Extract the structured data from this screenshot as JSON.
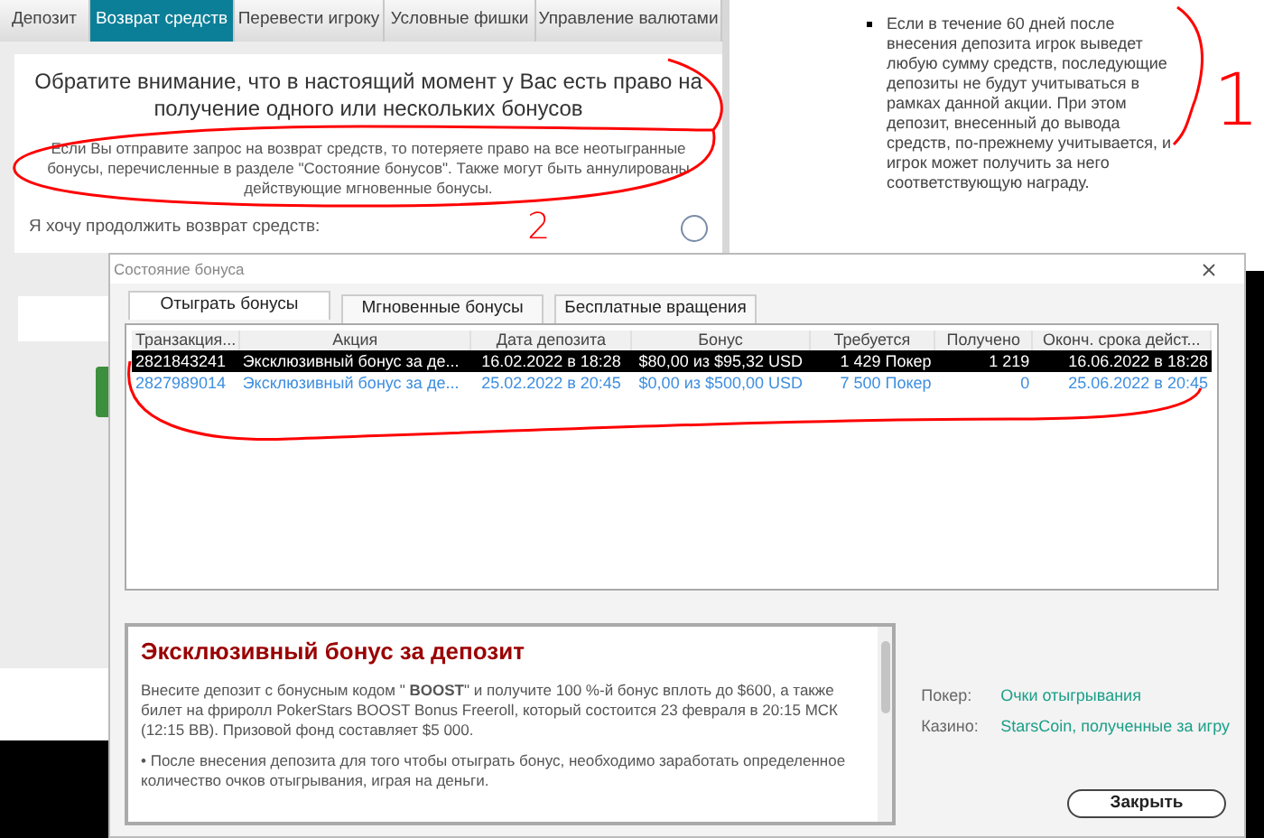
{
  "top_tabs": [
    {
      "label": "Депозит",
      "selected": false
    },
    {
      "label": "Возврат средств",
      "selected": true
    },
    {
      "label": "Перевести игроку",
      "selected": false
    },
    {
      "label": "Условные фишки",
      "selected": false
    },
    {
      "label": "Управление валютами",
      "selected": false
    }
  ],
  "notice": {
    "heading": "Обратите внимание, что в настоящий момент у Вас есть право на получение одного или нескольких бонусов",
    "text": "Если Вы отправите запрос на возврат средств, то потеряете право на все неотыгранные бонусы, перечисленные в разделе \"Состояние бонусов\". Также могут быть аннулированы действующие мгновенные бонусы.",
    "confirm_label": "Я хочу продолжить возврат средств:",
    "confirm_checked": false
  },
  "side_note": {
    "bullet": "Если в течение 60 дней после внесения депозита игрок выведет любую сумму средств, последующие депозиты не будут учитываться в рамках данной акции. При этом депозит, внесенный до вывода средств, по-прежнему учитывается, и игрок может получить за него соответствующую награду."
  },
  "annotations": [
    {
      "label": "1"
    },
    {
      "label": "2"
    }
  ],
  "dialog": {
    "title": "Состояние бонуса",
    "tabs": [
      {
        "label": "Отыграть бонусы",
        "selected": true
      },
      {
        "label": "Мгновенные бонусы",
        "selected": false
      },
      {
        "label": "Бесплатные вращения",
        "selected": false
      }
    ],
    "table": {
      "columns": [
        "Транзакция...",
        "Акция",
        "Дата депозита",
        "Бонус",
        "Требуется",
        "Получено",
        "Оконч. срока дейст..."
      ],
      "rows": [
        {
          "cells": [
            "2821843241",
            "Эксклюзивный бонус за де...",
            "16.02.2022 в 18:28",
            "$80,00 из $95,32 USD",
            "1 429 Покер",
            "1 219",
            "16.06.2022 в 18:28"
          ],
          "selected": true
        },
        {
          "cells": [
            "2827989014",
            "Эксклюзивный бонус за де...",
            "25.02.2022 в 20:45",
            "$0,00 из $500,00 USD",
            "7 500 Покер",
            "0",
            "25.06.2022 в 20:45"
          ],
          "selected": false
        }
      ]
    },
    "promo": {
      "title": "Эксклюзивный бонус за депозит",
      "paragraphs": [
        "Внесите депозит с бонусным кодом \" **BOOST**\" и получите 100 %-й бонус вплоть до $600, а также билет на фриролл PokerStars BOOST Bonus Freeroll, который состоится 23 февраля в 20:15 МСК (12:15 ВВ). Призовой фонд составляет $5 000.",
        "• После внесения депозита для того чтобы отыграть бонус, необходимо заработать определенное количество очков отыгрывания, играя на деньги."
      ]
    },
    "legend": [
      {
        "label": "Покер:",
        "value": "Очки отыгрывания"
      },
      {
        "label": "Казино:",
        "value": "StarsCoin, полученные за игру"
      }
    ],
    "close_button": "Закрыть"
  }
}
